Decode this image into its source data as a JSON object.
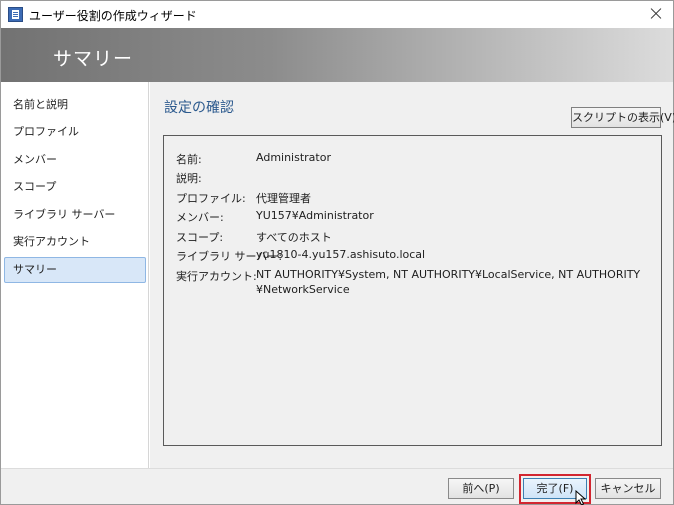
{
  "window": {
    "title": "ユーザー役割の作成ウィザード"
  },
  "banner": {
    "title": "サマリー"
  },
  "sidebar": {
    "items": [
      {
        "label": "名前と説明",
        "selected": false
      },
      {
        "label": "プロファイル",
        "selected": false
      },
      {
        "label": "メンバー",
        "selected": false
      },
      {
        "label": "スコープ",
        "selected": false
      },
      {
        "label": "ライブラリ サーバー",
        "selected": false
      },
      {
        "label": "実行アカウント",
        "selected": false
      },
      {
        "label": "サマリー",
        "selected": true
      }
    ]
  },
  "main": {
    "section_title": "設定の確認",
    "script_button_label": "スクリプトの表示(V)",
    "summary": [
      {
        "label": "名前:",
        "value": "Administrator"
      },
      {
        "label": "説明:",
        "value": ""
      },
      {
        "label": "プロファイル:",
        "value": "代理管理者"
      },
      {
        "label": "メンバー:",
        "value": "YU157¥Administrator"
      },
      {
        "label": "スコープ:",
        "value": "すべてのホスト"
      },
      {
        "label": "ライブラリ サーバー:",
        "value": "yu1810-4.yu157.ashisuto.local"
      },
      {
        "label": "実行アカウント:",
        "value": "NT AUTHORITY¥System, NT AUTHORITY¥LocalService, NT AUTHORITY ¥NetworkService"
      }
    ]
  },
  "footer": {
    "back_label": "前へ(P)",
    "finish_label": "完了(F)",
    "cancel_label": "キャンセル"
  },
  "colors": {
    "accent_title": "#2c5a8e",
    "selected_item_bg": "#d8e7f8",
    "highlight_frame": "#d22630"
  },
  "icons": {
    "app": "app-icon",
    "close": "close-icon",
    "cursor": "mouse-cursor-icon"
  }
}
